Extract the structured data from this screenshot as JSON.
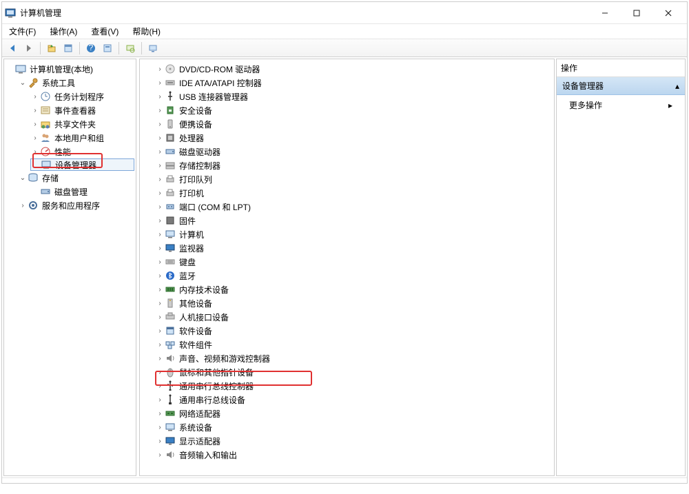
{
  "window": {
    "title": "计算机管理"
  },
  "menu": {
    "file": "文件(F)",
    "action": "操作(A)",
    "view": "查看(V)",
    "help": "帮助(H)"
  },
  "left_tree": {
    "root": "计算机管理(本地)",
    "system_tools": "系统工具",
    "task_scheduler": "任务计划程序",
    "event_viewer": "事件查看器",
    "shared_folders": "共享文件夹",
    "local_users": "本地用户和组",
    "performance": "性能",
    "device_manager": "设备管理器",
    "storage": "存储",
    "disk_management": "磁盘管理",
    "services": "服务和应用程序"
  },
  "center_tree": {
    "dvd": "DVD/CD-ROM 驱动器",
    "ide": "IDE ATA/ATAPI 控制器",
    "usb_conn": "USB 连接器管理器",
    "security": "安全设备",
    "portable": "便携设备",
    "processors": "处理器",
    "disk_drives": "磁盘驱动器",
    "storage_ctrl": "存储控制器",
    "print_queue": "打印队列",
    "printers": "打印机",
    "ports": "端口 (COM 和 LPT)",
    "firmware": "固件",
    "computer": "计算机",
    "monitors": "监视器",
    "keyboards": "键盘",
    "bluetooth": "蓝牙",
    "memory": "内存技术设备",
    "other": "其他设备",
    "hid": "人机接口设备",
    "sw_devices": "软件设备",
    "sw_components": "软件组件",
    "sound": "声音、视频和游戏控制器",
    "mouse": "鼠标和其他指针设备",
    "usb_ctrl": "通用串行总线控制器",
    "usb_dev": "通用串行总线设备",
    "network": "网络适配器",
    "system_dev": "系统设备",
    "display": "显示适配器",
    "audio_io": "音频输入和输出"
  },
  "actions": {
    "title": "操作",
    "section": "设备管理器",
    "more": "更多操作"
  }
}
